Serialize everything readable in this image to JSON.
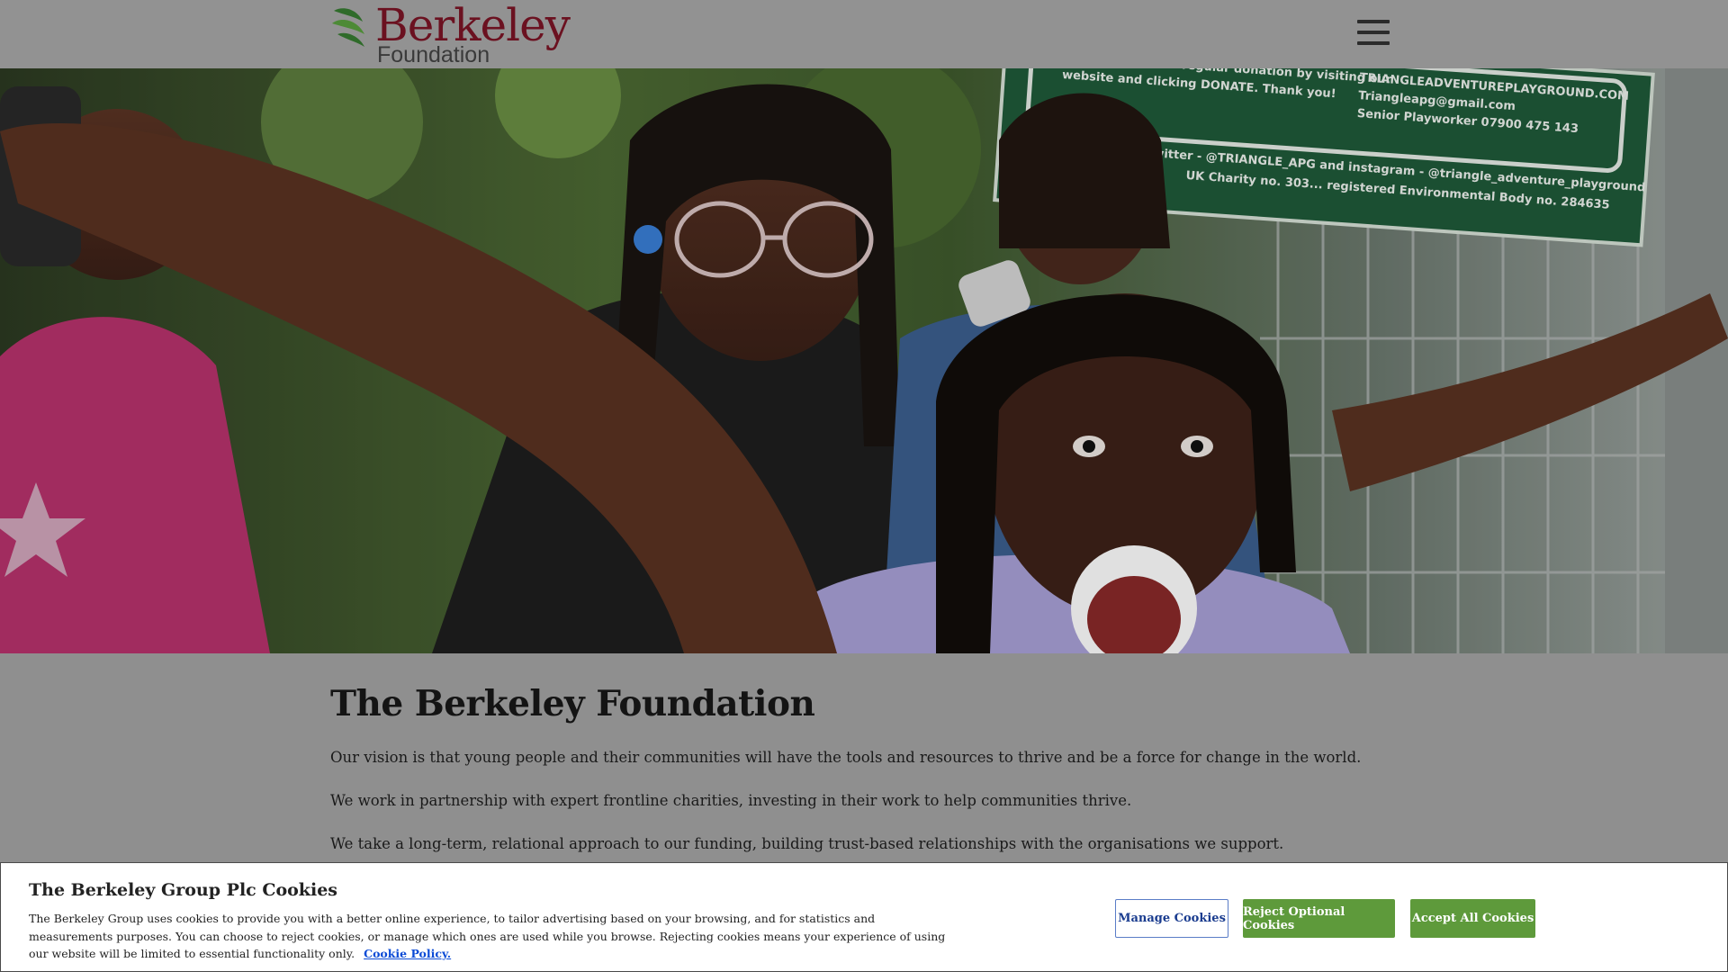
{
  "header": {
    "logo_word": "Berkeley",
    "logo_sub": "Foundation",
    "brand_color": "#6b1120",
    "menu_icon": "hamburger-menu-icon"
  },
  "hero": {
    "sign_lines": [
      "Make a one off or regular donation by visiting our",
      "website and clicking DONATE. Thank you!",
      "TRIANGLEADVENTUREPLAYGROUND.COM",
      "Triangleapg@gmail.com",
      "Senior Playworker 07900 475 143",
      "Follow us on twitter - @TRIANGLE_APG and instagram - @triangle_adventure_playground",
      "UK Charity no. 303... registered Environmental Body no. 284635"
    ]
  },
  "main": {
    "title": "The Berkeley Foundation",
    "paragraphs": [
      "Our vision is that young people and their communities will have the tools and resources to thrive and be a force for change in the world.",
      "We work in partnership with expert frontline charities, investing in their work to help communities thrive.",
      "We take a long-term, relational approach to our funding, building trust-based relationships with the organisations we support."
    ]
  },
  "cookie_banner": {
    "title": "The Berkeley Group Plc Cookies",
    "text": "The Berkeley Group uses cookies to provide you with a better online experience, to tailor advertising based on your browsing, and for statistics and measurements purposes. You can choose to reject cookies, or manage which ones are used while you browse. Rejecting cookies means your experience of using our website will be limited to essential functionality only.",
    "link_label": "Cookie Policy.",
    "manage_label": "Manage Cookies",
    "reject_label": "Reject Optional Cookies",
    "accept_label": "Accept All Cookies",
    "button_color": "#5e9a3b",
    "link_color": "#0b4bd6"
  }
}
